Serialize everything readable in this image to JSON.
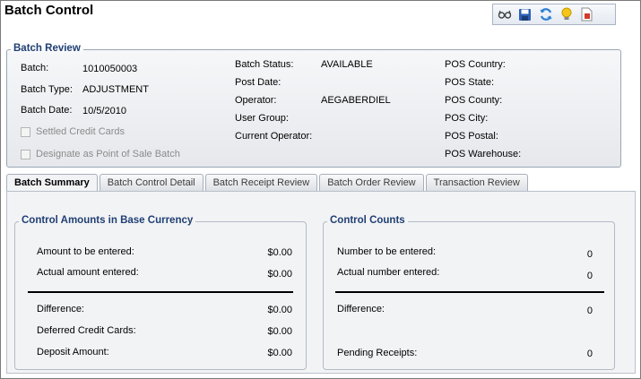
{
  "page": {
    "title": "Batch Control"
  },
  "toolbar": {
    "icons": [
      "glasses-icon",
      "save-icon",
      "refresh-icon",
      "lightbulb-icon",
      "document-icon"
    ]
  },
  "review": {
    "legend": "Batch Review",
    "batch_label": "Batch:",
    "batch_value": "1010050003",
    "batch_type_label": "Batch Type:",
    "batch_type_value": "ADJUSTMENT",
    "batch_date_label": "Batch Date:",
    "batch_date_value": "10/5/2010",
    "settled_credit_cards": "Settled Credit Cards",
    "designate_pos": "Designate as Point of Sale Batch",
    "batch_status_label": "Batch Status:",
    "batch_status_value": "AVAILABLE",
    "post_date_label": "Post Date:",
    "operator_label": "Operator:",
    "operator_value": "AEGABERDIEL",
    "user_group_label": "User Group:",
    "current_operator_label": "Current Operator:",
    "pos_country_label": "POS Country:",
    "pos_state_label": "POS State:",
    "pos_county_label": "POS County:",
    "pos_city_label": "POS City:",
    "pos_postal_label": "POS Postal:",
    "pos_warehouse_label": "POS Warehouse:"
  },
  "tabs": [
    {
      "label": "Batch Summary",
      "active": true
    },
    {
      "label": "Batch Control Detail",
      "active": false
    },
    {
      "label": "Batch Receipt Review",
      "active": false
    },
    {
      "label": "Batch Order Review",
      "active": false
    },
    {
      "label": "Transaction Review",
      "active": false
    }
  ],
  "amounts": {
    "legend": "Control Amounts in Base Currency",
    "to_be_entered_label": "Amount to be entered:",
    "to_be_entered_value": "$0.00",
    "actual_entered_label": "Actual amount entered:",
    "actual_entered_value": "$0.00",
    "difference_label": "Difference:",
    "difference_value": "$0.00",
    "deferred_label": "Deferred Credit Cards:",
    "deferred_value": "$0.00",
    "deposit_label": "Deposit Amount:",
    "deposit_value": "$0.00"
  },
  "counts": {
    "legend": "Control Counts",
    "to_be_entered_label": "Number to be entered:",
    "to_be_entered_value": "0",
    "actual_entered_label": "Actual number entered:",
    "actual_entered_value": "0",
    "difference_label": "Difference:",
    "difference_value": "0",
    "pending_label": "Pending Receipts:",
    "pending_value": "0"
  }
}
